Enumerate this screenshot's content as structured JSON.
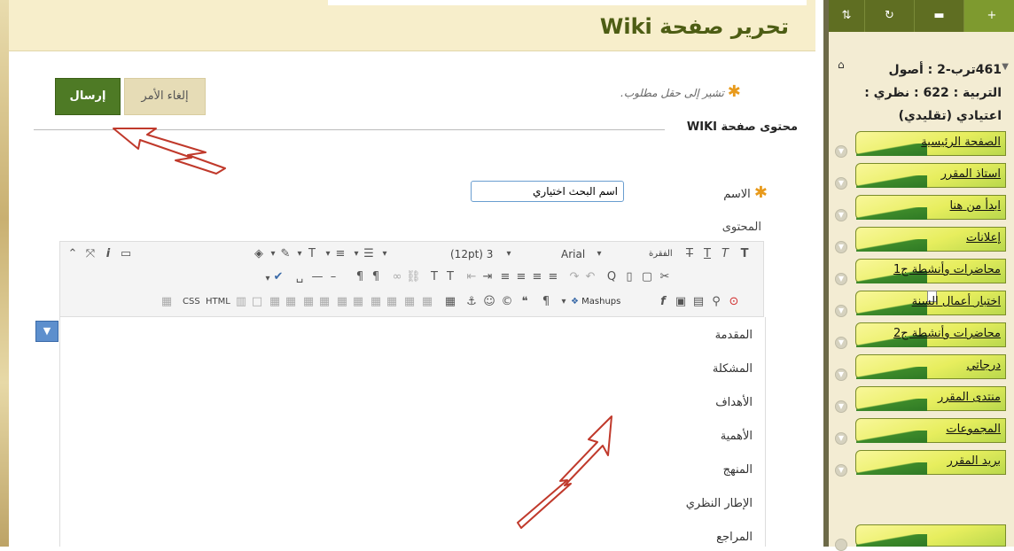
{
  "page_title": "تحرير صفحة Wiki",
  "required_note": "تشير إلى حقل مطلوب.",
  "buttons": {
    "cancel": "إلغاء الأمر",
    "submit": "إرسال"
  },
  "section_title": "محتوى صفحة WIKI",
  "form": {
    "name_label": "الاسم",
    "name_value": "اسم البحث اختياري",
    "content_label": "المحتوى"
  },
  "toolbar": {
    "font_size": "(12pt) 3",
    "font_family": "Arial",
    "paragraph": "الفقرة",
    "mashups": "Mashups",
    "css": "CSS",
    "html": "HTML"
  },
  "editor_lines": [
    "المقدمة",
    "المشكلة",
    "الأهداف",
    "الأهمية",
    "المنهج",
    "الإطار النظري",
    "المراجع"
  ],
  "sidebar": {
    "course_title": "461ترب-2 : أصول التربية : 622 : نظري : اعتيادي (تقليدي)",
    "items": [
      "الصفحة الرئيسية",
      "استاذ المقرر",
      "ابدأ من هنا",
      "إعلانات",
      "محاضرات وأنشطة ج1",
      "اختبار أعمال السنة",
      "محاضرات وأنشطة ج2",
      "درجاتي",
      "منتدى المقرر",
      "المجموعات",
      "بريد المقرر"
    ]
  },
  "colors": {
    "accent_green": "#4e7a25",
    "title_green": "#4d5d14",
    "arrow_red": "#c0392b"
  }
}
